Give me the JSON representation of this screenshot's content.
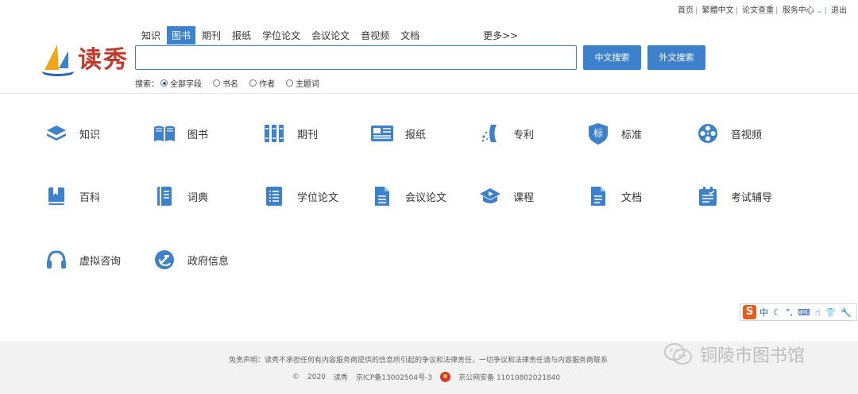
{
  "topbar": {
    "home": "首页",
    "traditional": "繁體中文",
    "paper_check": "论文查重",
    "service_center": "服务中心",
    "logout": "退出"
  },
  "logo": {
    "text": "读秀"
  },
  "tabs": [
    {
      "label": "知识",
      "active": false
    },
    {
      "label": "图书",
      "active": true
    },
    {
      "label": "期刊",
      "active": false
    },
    {
      "label": "报纸",
      "active": false
    },
    {
      "label": "学位论文",
      "active": false
    },
    {
      "label": "会议论文",
      "active": false
    },
    {
      "label": "音视频",
      "active": false
    },
    {
      "label": "文档",
      "active": false
    },
    {
      "label": "更多>>",
      "active": false
    }
  ],
  "search": {
    "value": "",
    "placeholder": "",
    "cn_button": "中文搜索",
    "fn_button": "外文搜索",
    "options_label": "搜索：",
    "options": [
      {
        "label": "全部字段",
        "selected": true
      },
      {
        "label": "书名",
        "selected": false
      },
      {
        "label": "作者",
        "selected": false
      },
      {
        "label": "主题词",
        "selected": false
      }
    ]
  },
  "categories": [
    {
      "label": "知识",
      "icon": "layers-icon"
    },
    {
      "label": "图书",
      "icon": "open-book-icon"
    },
    {
      "label": "期刊",
      "icon": "journals-icon"
    },
    {
      "label": "报纸",
      "icon": "newspaper-icon"
    },
    {
      "label": "专利",
      "icon": "patent-icon"
    },
    {
      "label": "标准",
      "icon": "standard-badge-icon"
    },
    {
      "label": "音视频",
      "icon": "film-reel-icon"
    },
    {
      "label": "百科",
      "icon": "bookmark-book-icon"
    },
    {
      "label": "词典",
      "icon": "dictionary-icon"
    },
    {
      "label": "学位论文",
      "icon": "thesis-list-icon"
    },
    {
      "label": "会议论文",
      "icon": "document-icon"
    },
    {
      "label": "课程",
      "icon": "course-play-icon"
    },
    {
      "label": "文档",
      "icon": "file-icon"
    },
    {
      "label": "考试辅导",
      "icon": "exam-clipboard-icon"
    },
    {
      "label": "虚拟咨询",
      "icon": "headphones-icon"
    },
    {
      "label": "政府信息",
      "icon": "government-emblem-icon"
    }
  ],
  "ime": {
    "logo": "S",
    "mode": "中"
  },
  "footer": {
    "disclaimer": "免责声明：读秀不承担任何有内容服务商提供的信息所引起的争议和法律责任，一切争议和法律责任请与内容服务商联系",
    "copyright": "©",
    "year": "2020",
    "brand": "读秀",
    "icp": "京ICP备13002504号-3",
    "police": "京公网安备 11010802021840"
  },
  "watermark": {
    "text": "铜陵市图书馆"
  },
  "colors": {
    "accent": "#3d80cc",
    "logo_red": "#c2382b"
  }
}
